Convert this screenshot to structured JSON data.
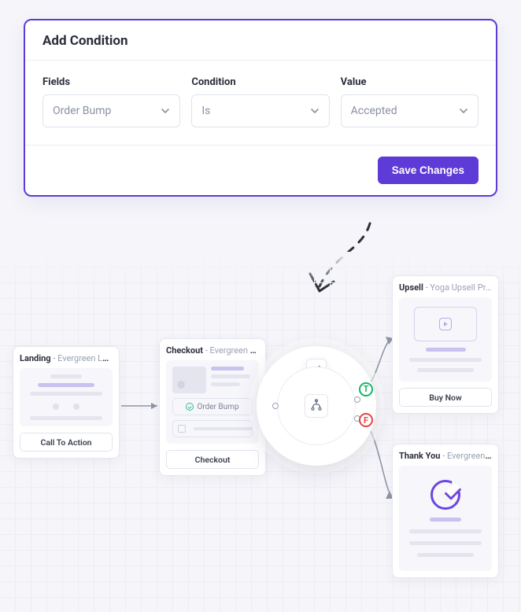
{
  "panel": {
    "title": "Add Condition",
    "fields_label": "Fields",
    "condition_label": "Condition",
    "value_label": "Value",
    "fields_value": "Order Bump",
    "condition_value": "Is",
    "value_value": "Accepted",
    "save_label": "Save Changes"
  },
  "nodes": {
    "landing": {
      "type": "Landing",
      "name": "Evergreen Lan…",
      "action": "Call To Action"
    },
    "checkout": {
      "type": "Checkout",
      "name": "Evergreen Che…",
      "bump_label": "Order Bump",
      "action": "Checkout"
    },
    "upsell": {
      "type": "Upsell",
      "name": "Yoga Upsell Pr…",
      "action": "Buy Now"
    },
    "thankyou": {
      "type": "Thank You",
      "name": "Evergreen Tha…"
    }
  },
  "split": {
    "t": "T",
    "f": "F"
  }
}
